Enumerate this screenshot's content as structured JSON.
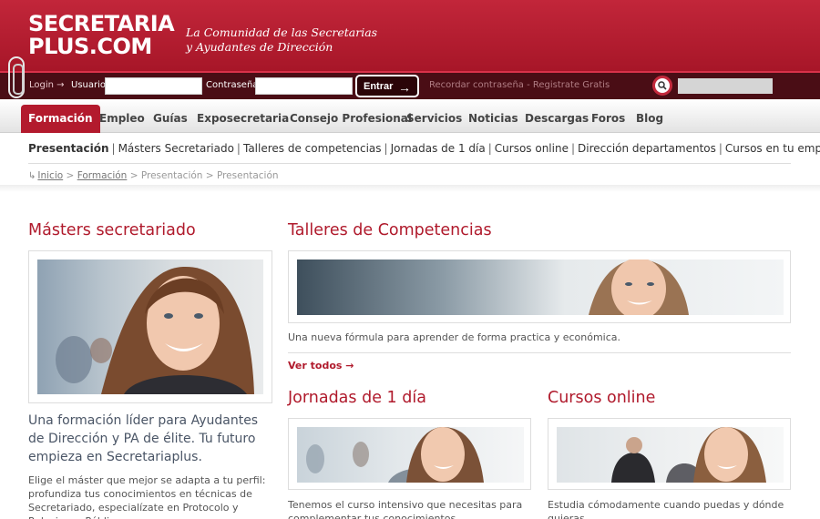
{
  "header": {
    "logo_line1": "SECRETARIA",
    "logo_line2": "PLUS.COM",
    "tagline_line1": "La Comunidad de las Secretarias",
    "tagline_line2": "y Ayudantes de Dirección"
  },
  "login": {
    "login_label": "Login →",
    "user_label": "Usuario",
    "password_label": "Contraseña",
    "submit_label": "Entrar",
    "submit_arrow": "→",
    "links": "Recordar contraseña - Registrate Gratis"
  },
  "nav": {
    "items": [
      "Formación",
      "Empleo",
      "Guías",
      "Exposecretaria",
      "Consejo Profesional",
      "Servicios",
      "Noticias",
      "Descargas",
      "Foros",
      "Blog"
    ]
  },
  "subnav": {
    "items": [
      "Presentación",
      "Másters Secretariado",
      "Talleres de competencias",
      "Jornadas de 1 día",
      "Cursos online",
      "Dirección departamentos",
      "Cursos en tu empresa"
    ]
  },
  "breadcrumb": {
    "icon": "↳",
    "home": "Inicio",
    "formacion": "Formación",
    "current1": "Presentación",
    "current2": "Presentación",
    "sep": ">"
  },
  "sections": {
    "masters": {
      "title": "Másters secretariado",
      "lead": "Una formación líder para Ayudantes de Dirección y PA de élite. Tu futuro empieza en Secretariaplus.",
      "text": "Elige el máster que mejor se adapta a tu perfil: profundiza tus conocimientos en técnicas de Secretariado, especialízate en Protocolo y Relaciones Públicas..."
    },
    "talleres": {
      "title": "Talleres de Competencias",
      "text": "Una nueva fórmula para aprender de forma practica y económica.",
      "more": "Ver todos →"
    },
    "jornadas": {
      "title": "Jornadas de 1 día",
      "text": "Tenemos el curso intensivo que necesitas para complementar tus conocimientos"
    },
    "cursos": {
      "title": "Cursos online",
      "text": "Estudia cómodamente cuando puedas y dónde quieras"
    }
  },
  "colors": {
    "brand": "#b31a2d",
    "dark": "#4a0d15"
  }
}
